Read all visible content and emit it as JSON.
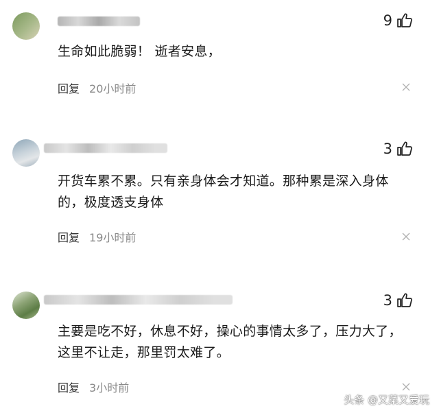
{
  "comments": [
    {
      "author": "",
      "likes": "9",
      "text": "生命如此脆弱！ 逝者安息，",
      "reply_label": "回复",
      "time": "20小时前"
    },
    {
      "author": "",
      "likes": "3",
      "text": "开货车累不累。只有亲身体会才知道。那种累是深入身体的，极度透支身体",
      "reply_label": "回复",
      "time": "19小时前"
    },
    {
      "author": "",
      "likes": "3",
      "text": "主要是吃不好，休息不好，操心的事情太多了，压力大了，这里不让走，那里罚太难了。",
      "reply_label": "回复",
      "time": "3小时前"
    }
  ],
  "watermark": {
    "text": "头条 @又菜又爱玩"
  },
  "icons": {
    "like": "thumbs-up-icon",
    "dismiss": "close-icon",
    "avatar": "avatar"
  },
  "colors": {
    "text": "#1b1b1b",
    "muted": "#8a8a8a",
    "background": "#ffffff"
  }
}
